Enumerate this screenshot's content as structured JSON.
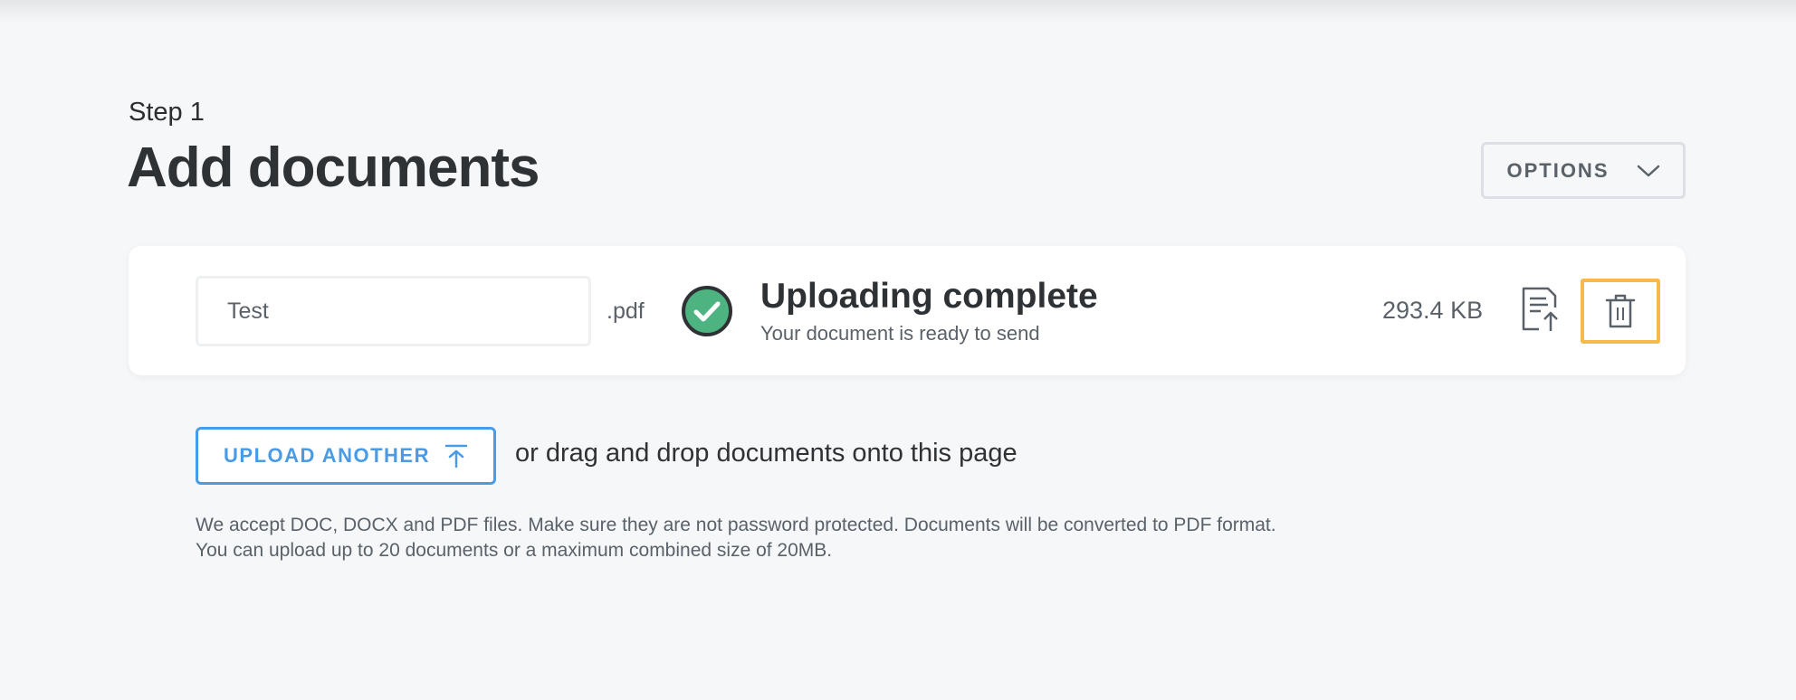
{
  "header": {
    "step": "Step 1",
    "title": "Add documents",
    "options_label": "OPTIONS"
  },
  "document": {
    "name_value": "",
    "name_placeholder": "Test",
    "extension": ".pdf",
    "status_title": "Uploading complete",
    "status_subtitle": "Your document is ready to send",
    "size": "293.4 KB"
  },
  "upload": {
    "button_label": "UPLOAD ANOTHER",
    "drag_text": "or drag and drop documents onto this page"
  },
  "info": {
    "line1": "We accept DOC, DOCX and PDF files. Make sure they are not password protected. Documents will be converted to PDF format.",
    "line2": "You can upload up to 20 documents or a maximum combined size of 20MB."
  },
  "colors": {
    "accent": "#4a9be6",
    "success": "#4db380",
    "focus": "#f5b94d",
    "background": "#f6f7f9"
  },
  "icons": {
    "options": "chevron-down-icon",
    "status": "check-circle-icon",
    "replace": "document-upload-icon",
    "delete": "trash-icon",
    "upload": "arrow-up-icon"
  }
}
